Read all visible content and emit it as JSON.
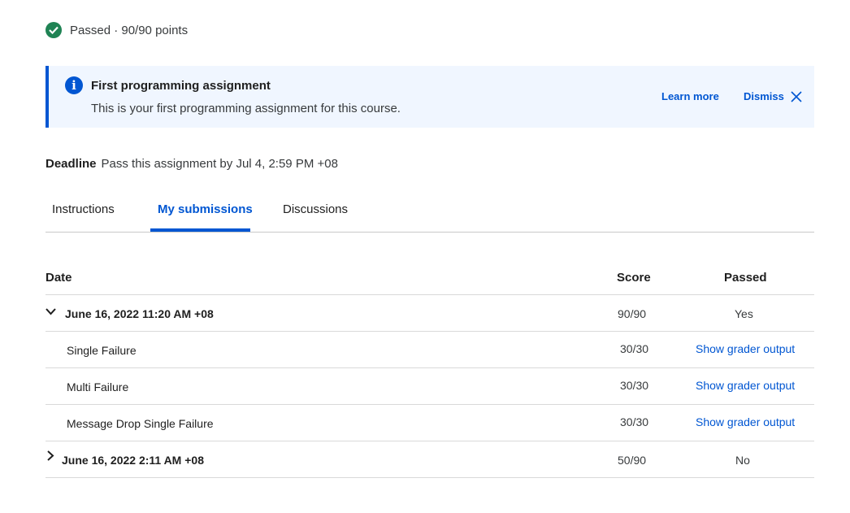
{
  "status": {
    "text": "Passed · 90/90 points",
    "color": "#1f8354",
    "icon": "check-circle-icon"
  },
  "banner": {
    "title": "First programming assignment",
    "description": "This is your first programming assignment for this course.",
    "learn_more": "Learn more",
    "dismiss": "Dismiss",
    "accent": "#0056d2",
    "background": "#f0f6ff"
  },
  "deadline": {
    "label": "Deadline",
    "text": "Pass this assignment by Jul 4, 2:59 PM +08"
  },
  "tabs": [
    {
      "label": "Instructions",
      "active": false
    },
    {
      "label": "My submissions",
      "active": true
    },
    {
      "label": "Discussions",
      "active": false
    }
  ],
  "table": {
    "headers": {
      "date": "Date",
      "score": "Score",
      "passed": "Passed"
    },
    "submissions": [
      {
        "date": "June 16, 2022 11:20 AM +08",
        "score": "90/90",
        "passed": "Yes",
        "expanded": true,
        "parts": [
          {
            "name": "Single Failure",
            "score": "30/30",
            "action": "Show grader output"
          },
          {
            "name": "Multi Failure",
            "score": "30/30",
            "action": "Show grader output"
          },
          {
            "name": "Message Drop Single Failure",
            "score": "30/30",
            "action": "Show grader output"
          }
        ]
      },
      {
        "date": "June 16, 2022 2:11 AM +08",
        "score": "50/90",
        "passed": "No",
        "expanded": false
      }
    ]
  }
}
